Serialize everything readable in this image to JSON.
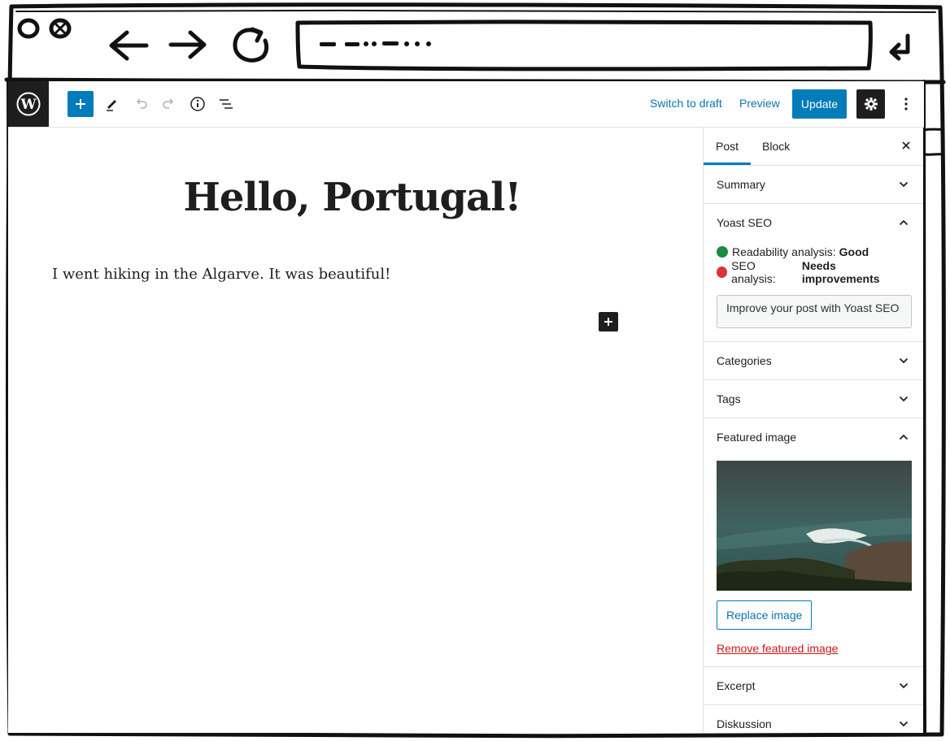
{
  "browser": {
    "url_placeholder": "",
    "icons": [
      "close-circle-icon",
      "close-x-icon",
      "back-arrow-icon",
      "forward-arrow-icon",
      "reload-icon",
      "enter-icon"
    ]
  },
  "toolbar": {
    "switch_to_draft": "Switch to draft",
    "preview": "Preview",
    "update": "Update"
  },
  "post": {
    "title": "Hello, Portugal!",
    "paragraph": "I went hiking in the Algarve. It was beautiful!"
  },
  "sidebar": {
    "tabs": [
      "Post",
      "Block"
    ],
    "active_tab": "Post",
    "panels": {
      "summary": "Summary",
      "yoast": "Yoast SEO",
      "categories": "Categories",
      "tags": "Tags",
      "featured_image": "Featured image",
      "excerpt": "Excerpt",
      "discussion": "Diskussion"
    },
    "yoast": {
      "readability_label": "Readability analysis:",
      "readability_value": "Good",
      "seo_label": "SEO analysis:",
      "seo_value": "Needs improvements",
      "button": "Improve your post with Yoast SEO"
    },
    "featured": {
      "replace": "Replace image",
      "remove": "Remove featured image"
    }
  },
  "colors": {
    "accent": "#007cba",
    "dark": "#1e1e1e",
    "good": "#1a8c3f",
    "bad": "#d63638",
    "danger_link": "#cc1818"
  }
}
